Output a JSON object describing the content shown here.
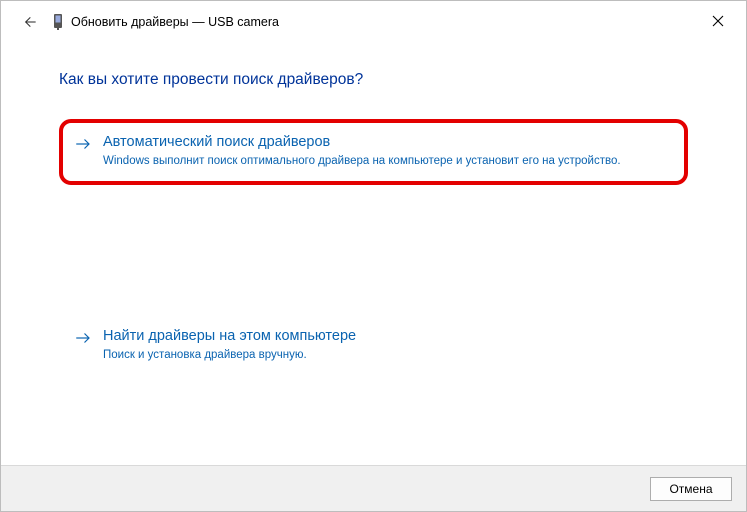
{
  "titlebar": {
    "title": "Обновить драйверы — USB camera"
  },
  "heading": "Как вы хотите провести поиск драйверов?",
  "options": {
    "auto": {
      "title": "Автоматический поиск драйверов",
      "desc": "Windows выполнит поиск оптимального драйвера на компьютере и установит его на устройство."
    },
    "manual": {
      "title": "Найти драйверы на этом компьютере",
      "desc": "Поиск и установка драйвера вручную."
    }
  },
  "footer": {
    "cancel": "Отмена"
  }
}
